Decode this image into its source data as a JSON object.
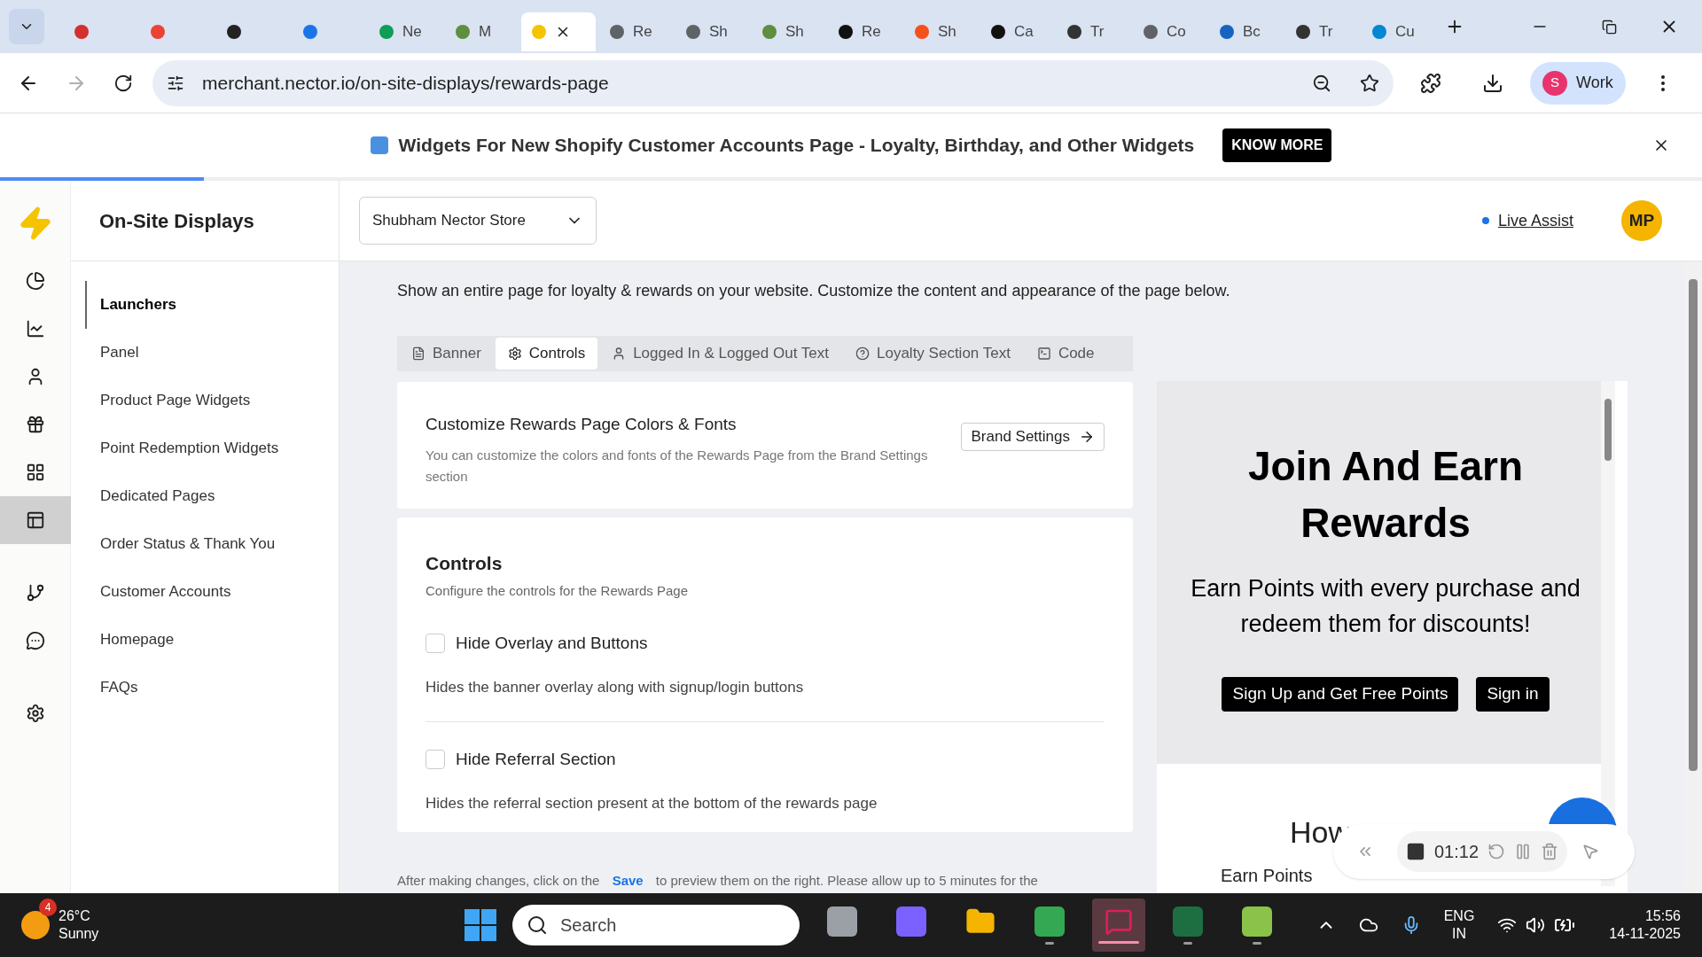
{
  "browser": {
    "tabs": [
      {
        "color": "#d32f2f",
        "selected": false
      },
      {
        "color": "#ea4335",
        "selected": false
      },
      {
        "color": "#222222",
        "selected": false
      },
      {
        "color": "#1a73e8",
        "selected": false
      },
      {
        "title": "Ne",
        "color": "#0f9d58",
        "selected": false
      },
      {
        "title": "M",
        "color": "#5e8e3e",
        "selected": false
      },
      {
        "color": "#f5c400",
        "selected": true
      },
      {
        "title": "Re",
        "color": "#5f6368",
        "selected": false
      },
      {
        "title": "Sh",
        "color": "#5f6368",
        "selected": false
      },
      {
        "title": "Sh",
        "color": "#5e8e3e",
        "selected": false
      },
      {
        "title": "Re",
        "color": "#111111",
        "selected": false
      },
      {
        "title": "Sh",
        "color": "#f4511e",
        "selected": false
      },
      {
        "title": "Ca",
        "color": "#111111",
        "selected": false
      },
      {
        "title": "Tr",
        "color": "#333333",
        "selected": false
      },
      {
        "title": "Co",
        "color": "#5f6368",
        "selected": false
      },
      {
        "title": "Bc",
        "color": "#1565c0",
        "selected": false
      },
      {
        "title": "Tr",
        "color": "#333333",
        "selected": false
      },
      {
        "title": "Cu",
        "color": "#0288d1",
        "selected": false
      }
    ],
    "url": "merchant.nector.io/on-site-displays/rewards-page",
    "profile": {
      "initial": "S",
      "label": "Work"
    }
  },
  "announcement": {
    "text": "Widgets For New Shopify Customer Accounts Page - Loyalty, Birthday, and Other Widgets",
    "button": "KNOW MORE"
  },
  "loading_bar": {
    "level": 0.12
  },
  "rail": [
    {
      "kind": "pie",
      "selected": false
    },
    {
      "kind": "line",
      "selected": false
    },
    {
      "kind": "user",
      "selected": false
    },
    {
      "kind": "gift",
      "selected": false
    },
    {
      "kind": "grid",
      "selected": false
    },
    {
      "kind": "layout",
      "selected": true
    },
    {
      "kind": "branch",
      "selected": false
    },
    {
      "kind": "chat",
      "selected": false
    },
    {
      "kind": "settings",
      "selected": false
    }
  ],
  "nav": {
    "title": "On-Site Displays",
    "items": [
      {
        "label": "Launchers",
        "selected": true
      },
      {
        "label": "Panel",
        "selected": false
      },
      {
        "label": "Product Page Widgets",
        "selected": false
      },
      {
        "label": "Point Redemption Widgets",
        "selected": false
      },
      {
        "label": "Dedicated Pages",
        "selected": false
      },
      {
        "label": "Order Status & Thank You",
        "selected": false
      },
      {
        "label": "Customer Accounts",
        "selected": false
      },
      {
        "label": "Homepage",
        "selected": false
      },
      {
        "label": "FAQs",
        "selected": false
      }
    ]
  },
  "header": {
    "store": "Shubham Nector Store",
    "live_assist": "Live Assist",
    "avatar": "MP"
  },
  "page": {
    "description": "Show an entire page for loyalty & rewards on your website. Customize the content and appearance of the page below.",
    "tabs": [
      {
        "label": "Banner",
        "kind": "file",
        "selected": false
      },
      {
        "label": "Controls",
        "kind": "gear",
        "selected": true
      },
      {
        "label": "Logged In & Logged Out Text",
        "kind": "user",
        "selected": false
      },
      {
        "label": "Loyalty Section Text",
        "kind": "help",
        "selected": false
      },
      {
        "label": "Code",
        "kind": "terminal",
        "selected": false
      }
    ],
    "brand_card": {
      "title": "Customize Rewards Page Colors & Fonts",
      "text": "You can customize the colors and fonts of the Rewards Page from the Brand Settings section",
      "button": "Brand Settings"
    },
    "controls": {
      "title": "Controls",
      "subtitle": "Configure the controls for the Rewards Page",
      "options": [
        {
          "label": "Hide Overlay and Buttons",
          "description": "Hides the banner overlay along with signup/login buttons",
          "checked": false
        },
        {
          "label": "Hide Referral Section",
          "description": "Hides the referral section present at the bottom of the rewards page",
          "checked": false
        }
      ]
    },
    "footer": {
      "before": "After making changes, click on the",
      "link": "Save",
      "after": "to preview them on the right. Please allow up to 5 minutes for the"
    }
  },
  "preview": {
    "title": "Join And Earn Rewards",
    "text": "Earn Points with every purchase and redeem them for discounts!",
    "buttons": [
      "Sign Up and Get Free Points",
      "Sign in"
    ],
    "section_title": "How",
    "section_text": "Earn Points"
  },
  "recorder": {
    "time": "01:12"
  },
  "taskbar": {
    "weather": {
      "badge": "4",
      "temp": "26°C",
      "condition": "Sunny"
    },
    "search": {
      "placeholder": "Search"
    },
    "apps": [
      {
        "kind": "taskview",
        "running": false,
        "selected": false
      },
      {
        "kind": "copilot",
        "running": false,
        "selected": false
      },
      {
        "kind": "folder",
        "running": false,
        "selected": false
      },
      {
        "kind": "chrome",
        "running": true,
        "selected": false
      },
      {
        "kind": "slack",
        "running": true,
        "selected": true
      },
      {
        "kind": "excel",
        "running": true,
        "selected": false
      },
      {
        "kind": "notepad",
        "running": true,
        "selected": false
      }
    ],
    "lang": "ENG",
    "region": "IN",
    "time": "15:56",
    "date": "14-11-2025"
  }
}
